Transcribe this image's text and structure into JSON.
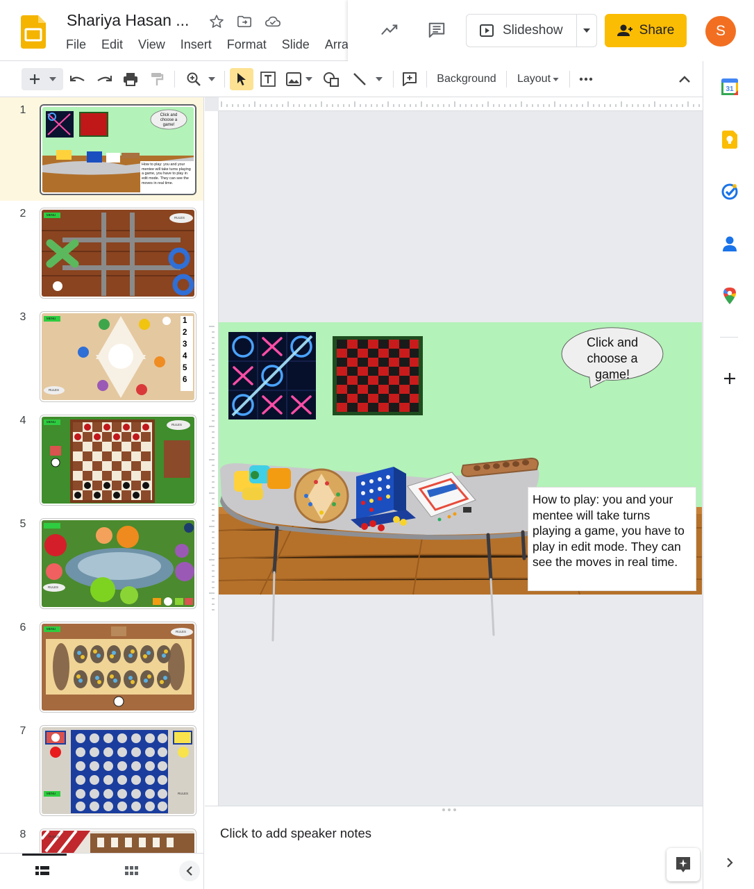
{
  "app": {
    "name": "Google Slides"
  },
  "header": {
    "title": "Shariya Hasan ...",
    "menu": [
      "File",
      "Edit",
      "View",
      "Insert",
      "Format",
      "Slide",
      "Arra"
    ],
    "slideshow_label": "Slideshow",
    "share_label": "Share",
    "avatar_initial": "S",
    "colors": {
      "share": "#fbbc04",
      "avatar": "#f26f21",
      "logo": "#f4b400"
    }
  },
  "toolbar": {
    "background_label": "Background",
    "layout_label": "Layout"
  },
  "filmstrip": {
    "slides": [
      {
        "number": "1",
        "selected": true
      },
      {
        "number": "2"
      },
      {
        "number": "3"
      },
      {
        "number": "4"
      },
      {
        "number": "5"
      },
      {
        "number": "6"
      },
      {
        "number": "7"
      },
      {
        "number": "8"
      }
    ],
    "thumb_text": {
      "s1_bubble": "Click and choose a game!",
      "s1_howto": "How to play: you and your mentee will take turns playing a game, you have to play in edit mode. They can see the moves in real time.",
      "menu": "MENU",
      "rules": "RULES",
      "s3_numbers": [
        "1",
        "2",
        "3",
        "4",
        "5",
        "6"
      ]
    }
  },
  "slide": {
    "bubble_text": "Click and choose a game!",
    "howto_text": "How to play: you and your mentee will take turns playing a game, you have to play in edit mode. They can see the moves in real time.",
    "colors": {
      "wall": "#b3f2b8",
      "floor": "#b5712a",
      "table": "#c9c9cc"
    }
  },
  "notes": {
    "placeholder": "Click to add speaker notes"
  },
  "side_panel": {
    "icons": [
      "calendar-icon",
      "keep-icon",
      "tasks-icon",
      "contacts-icon",
      "maps-icon",
      "add-icon"
    ]
  }
}
